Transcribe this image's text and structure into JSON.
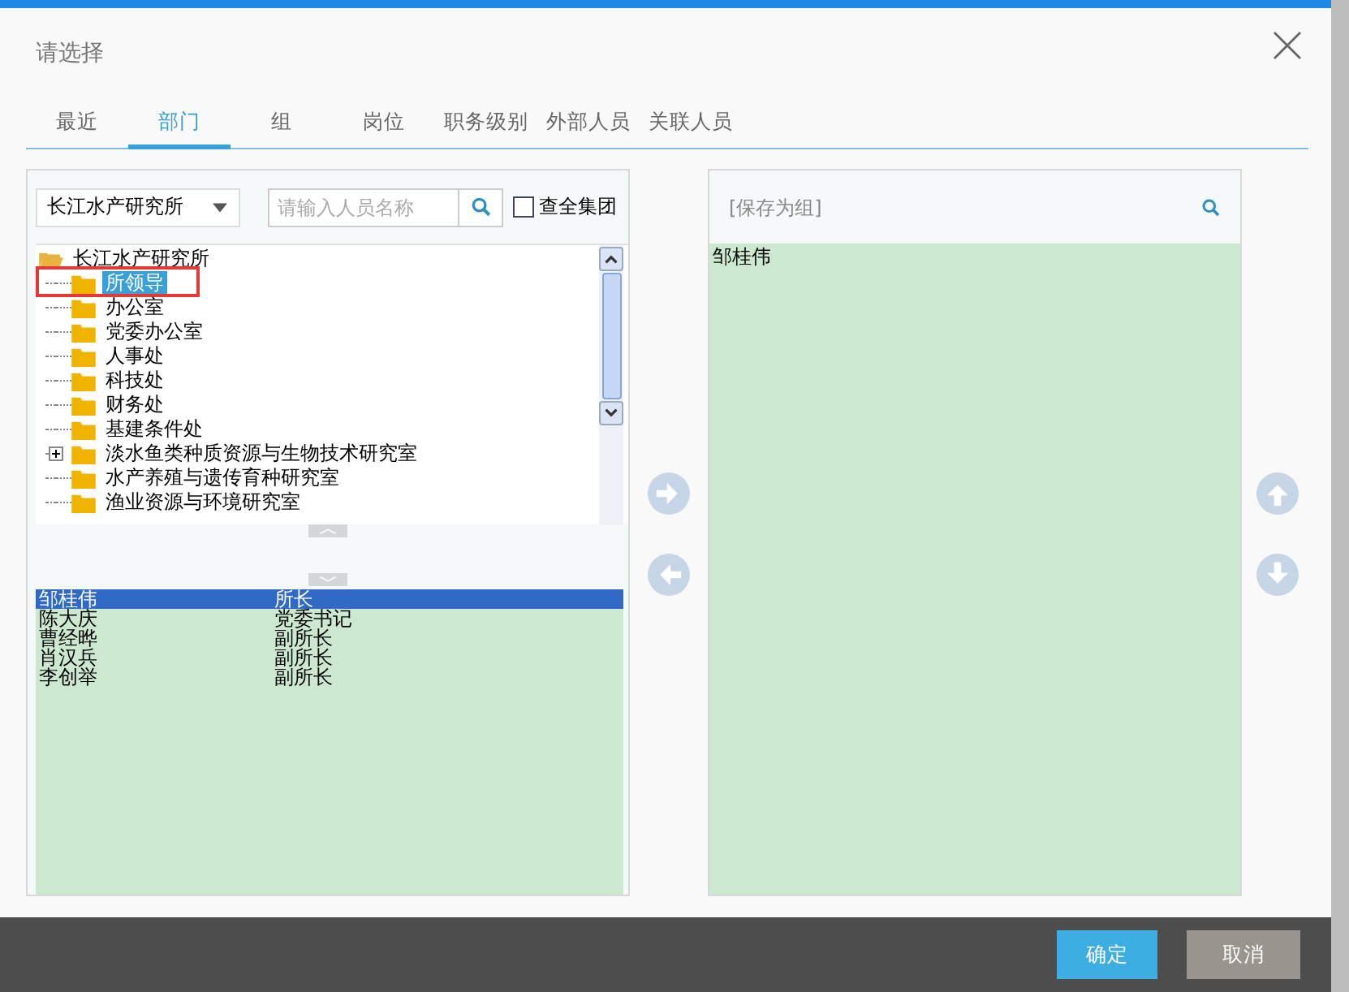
{
  "dialog": {
    "title": "请选择"
  },
  "tabs": [
    {
      "label": "最近",
      "selected": false
    },
    {
      "label": "部门",
      "selected": true
    },
    {
      "label": "组",
      "selected": false
    },
    {
      "label": "岗位",
      "selected": false
    },
    {
      "label": "职务级别",
      "selected": false
    },
    {
      "label": "外部人员",
      "selected": false
    },
    {
      "label": "关联人员",
      "selected": false
    }
  ],
  "org_select": {
    "value": "长江水产研究所"
  },
  "person_search": {
    "placeholder": "请输入人员名称"
  },
  "whole_group": {
    "label": "查全集团",
    "checked": false
  },
  "tree": {
    "label": "长江水产研究所",
    "expanded": true,
    "children": [
      {
        "label": "所领导",
        "kind": "leaf",
        "selected": true,
        "highlighted": true
      },
      {
        "label": "办公室",
        "kind": "leaf",
        "selected": false,
        "highlighted": false
      },
      {
        "label": "党委办公室",
        "kind": "leaf",
        "selected": false,
        "highlighted": false
      },
      {
        "label": "人事处",
        "kind": "leaf",
        "selected": false,
        "highlighted": false
      },
      {
        "label": "科技处",
        "kind": "leaf",
        "selected": false,
        "highlighted": false
      },
      {
        "label": "财务处",
        "kind": "leaf",
        "selected": false,
        "highlighted": false
      },
      {
        "label": "基建条件处",
        "kind": "leaf",
        "selected": false,
        "highlighted": false
      },
      {
        "label": "淡水鱼类种质资源与生物技术研究室",
        "kind": "branch",
        "expanded": false,
        "selected": false,
        "highlighted": false
      },
      {
        "label": "水产养殖与遗传育种研究室",
        "kind": "leaf",
        "selected": false,
        "highlighted": false
      },
      {
        "label": "渔业资源与环境研究室",
        "kind": "leaf",
        "selected": false,
        "highlighted": false
      }
    ]
  },
  "members": [
    {
      "name": "邹桂伟",
      "position": "所长",
      "selected": true
    },
    {
      "name": "陈大庆",
      "position": "党委书记",
      "selected": false
    },
    {
      "name": "曹经晔",
      "position": "副所长",
      "selected": false
    },
    {
      "name": "肖汉兵",
      "position": "副所长",
      "selected": false
    },
    {
      "name": "李创举",
      "position": "副所长",
      "selected": false
    }
  ],
  "save_group_field": {
    "placeholder": "[保存为组]"
  },
  "chosen": [
    "邹桂伟"
  ],
  "buttons": [
    {
      "label": "确定",
      "kind": "primary"
    },
    {
      "label": "取消",
      "kind": "secondary"
    }
  ]
}
